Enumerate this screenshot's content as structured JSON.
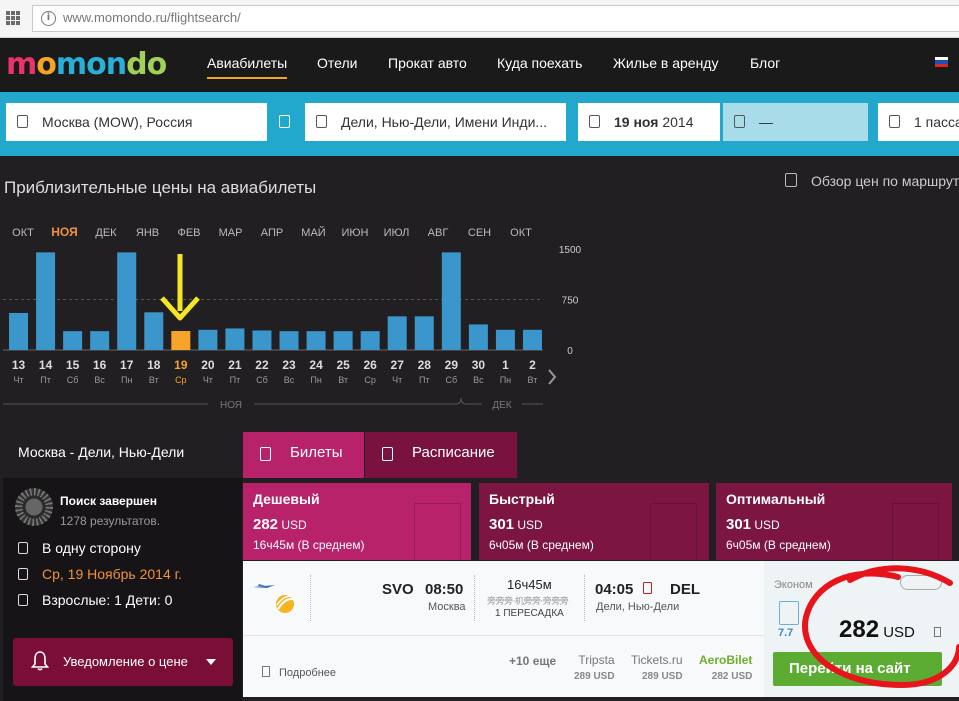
{
  "browser": {
    "url": "www.momondo.ru/flightsearch/"
  },
  "header": {
    "logo": {
      "part1": "m",
      "part2": "o",
      "part3": "mon",
      "part4": "do"
    },
    "nav": [
      {
        "label": "Авиабилеты",
        "active": true
      },
      {
        "label": "Отели"
      },
      {
        "label": "Прокат авто"
      },
      {
        "label": "Куда поехать"
      },
      {
        "label": "Жилье в аренду"
      },
      {
        "label": "Блог"
      }
    ],
    "flag": [
      "#ffffff",
      "#1f4fb5",
      "#d52b1e"
    ]
  },
  "search": {
    "origin": "Москва (MOW), Россия",
    "destination": "Дели, Нью-Дели, Имени Инди...",
    "depart_date_bold": "19 ноя",
    "depart_date_year": " 2014",
    "return_date": "—",
    "passengers": "1 пасса"
  },
  "chart": {
    "title": "Приблизительные цены на авиабилеты",
    "overview_label": "Обзор цен по маршруту",
    "months": [
      "ОКТ",
      "НОЯ",
      "ДЕК",
      "ЯНВ",
      "ФЕВ",
      "МАР",
      "АПР",
      "МАЙ",
      "ИЮН",
      "ИЮЛ",
      "АВГ",
      "СЕН",
      "ОКТ"
    ],
    "current_month": "НОЯ",
    "ytick_labels": [
      "1500",
      "750",
      "0"
    ],
    "range_labels": {
      "nov": "НОЯ",
      "dec": "ДЕК"
    },
    "annotation_arrow_color": "#f5e625"
  },
  "chart_data": {
    "type": "bar",
    "title": "Приблизительные цены на авиабилеты",
    "ylim": [
      0,
      1500
    ],
    "yticks": [
      0,
      750,
      1500
    ],
    "categories": [
      "13 Чт",
      "14 Пт",
      "15 Сб",
      "16 Вс",
      "17 Пн",
      "18 Вт",
      "19 Ср",
      "20 Чт",
      "21 Пт",
      "22 Сб",
      "23 Вс",
      "24 Пн",
      "25 Вт",
      "26 Ср",
      "27 Чт",
      "28 Пт",
      "29 Сб",
      "30 Вс",
      "1 Пн",
      "2 Вт"
    ],
    "days": [
      "13",
      "14",
      "15",
      "16",
      "17",
      "18",
      "19",
      "20",
      "21",
      "22",
      "23",
      "24",
      "25",
      "26",
      "27",
      "28",
      "29",
      "30",
      "1",
      "2"
    ],
    "weekdays": [
      "Чт",
      "Пт",
      "Сб",
      "Вс",
      "Пн",
      "Вт",
      "Ср",
      "Чт",
      "Пт",
      "Сб",
      "Вс",
      "Пн",
      "Вт",
      "Ср",
      "Чт",
      "Пт",
      "Сб",
      "Вс",
      "Пн",
      "Вт"
    ],
    "values": [
      550,
      1450,
      280,
      280,
      1450,
      560,
      282,
      300,
      320,
      290,
      280,
      280,
      280,
      280,
      500,
      500,
      1450,
      380,
      300,
      300
    ],
    "selected_index": 6,
    "colors": {
      "bar": "#3b96cc",
      "selected": "#f7a52a"
    }
  },
  "results": {
    "route": "Москва - Дели, Нью-Дели",
    "tabs": [
      {
        "label": "Билеты",
        "color": "#b8226a"
      },
      {
        "label": "Расписание",
        "color": "#7a1240"
      }
    ],
    "status": "Поиск завершен",
    "results_count": "1278 результатов.",
    "filters": {
      "trip_type": "В одну сторону",
      "date": "Ср, 19 Ноябрь 2014 г.",
      "passengers": "Взрослые: 1 Дети: 0"
    },
    "price_alert": "Уведомление о цене",
    "sort": [
      {
        "title": "Дешевый",
        "price": "282",
        "currency": " USD",
        "duration": "16ч45м (В среднем)",
        "color": "#b8226a"
      },
      {
        "title": "Быстрый",
        "price": "301",
        "currency": " USD",
        "duration": "6ч05м (В среднем)",
        "color": "#7d1543"
      },
      {
        "title": "Оптимальный",
        "price": "301",
        "currency": " USD",
        "duration": "6ч05м (В среднем)",
        "color": "#7d1543"
      }
    ],
    "flight": {
      "dep_code": "SVO",
      "dep_time": "08:50",
      "dep_city": "Москва",
      "duration": "16ч45м",
      "stop_icons": "旁旁旁·机旁旁·旁旁旁",
      "stops": "1 ПЕРЕСАДКА",
      "arr_time": "04:05",
      "arr_code": "DEL",
      "arr_city": "Дели, Нью-Дели"
    },
    "details_link": "Подробнее",
    "more_link": "+10 еще",
    "providers": [
      {
        "name": "Tripsta",
        "price": "289 USD"
      },
      {
        "name": "Tickets.ru",
        "price": "289 USD"
      },
      {
        "name": "AeroBilet",
        "price": "282 USD"
      }
    ],
    "class_label": "Эконом",
    "partial_price": "7.7",
    "price": "282",
    "currency": " USD",
    "goto_button": "Перейти на сайт",
    "annotation_color": "#e8141c"
  }
}
